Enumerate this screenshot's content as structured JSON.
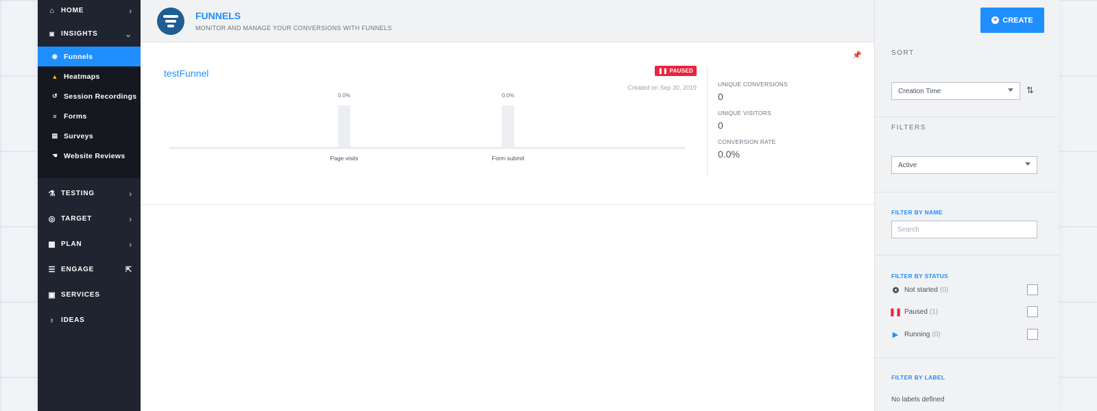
{
  "sidebar": {
    "items": [
      {
        "label": "HOME",
        "icon": "home-icon",
        "glyph": "⌂",
        "trail": "›"
      },
      {
        "label": "INSIGHTS",
        "icon": "insights-icon",
        "glyph": "◙",
        "trail": "⌄"
      }
    ],
    "sub_items": [
      {
        "label": "Funnels",
        "icon": "funnel-icon",
        "glyph": "◉"
      },
      {
        "label": "Heatmaps",
        "icon": "heatmap-icon",
        "glyph": "▲"
      },
      {
        "label": "Session Recordings",
        "icon": "recording-icon",
        "glyph": "↺"
      },
      {
        "label": "Forms",
        "icon": "forms-icon",
        "glyph": "≡"
      },
      {
        "label": "Surveys",
        "icon": "surveys-icon",
        "glyph": "▤"
      },
      {
        "label": "Website Reviews",
        "icon": "reviews-icon",
        "glyph": "☚"
      }
    ],
    "lower_items": [
      {
        "label": "TESTING",
        "icon": "testing-icon",
        "glyph": "⚗",
        "trail": "›"
      },
      {
        "label": "TARGET",
        "icon": "target-icon",
        "glyph": "◎",
        "trail": "›"
      },
      {
        "label": "PLAN",
        "icon": "plan-icon",
        "glyph": "▦",
        "trail": "›"
      },
      {
        "label": "ENGAGE",
        "icon": "engage-icon",
        "glyph": "☰",
        "trail": "⇱"
      },
      {
        "label": "SERVICES",
        "icon": "services-icon",
        "glyph": "▣",
        "trail": ""
      },
      {
        "label": "IDEAS",
        "icon": "ideas-icon",
        "glyph": "♁",
        "trail": ""
      }
    ]
  },
  "header": {
    "title": "FUNNELS",
    "subtitle": "MONITOR AND MANAGE YOUR CONVERSIONS WITH FUNNELS",
    "create_label": "CREATE"
  },
  "funnel": {
    "name": "testFunnel",
    "status_badge": "PAUSED",
    "created": "Created on Sep 30, 2019",
    "stats": [
      {
        "label": "UNIQUE CONVERSIONS",
        "value": "0"
      },
      {
        "label": "UNIQUE VISITORS",
        "value": "0"
      },
      {
        "label": "CONVERSION RATE",
        "value": "0.0%"
      }
    ]
  },
  "chart_data": {
    "type": "bar",
    "categories": [
      "Page visits",
      "Form submit"
    ],
    "values": [
      0.0,
      0.0
    ],
    "data_labels": [
      "0.0%",
      "0.0%"
    ],
    "ylim": [
      0,
      100
    ]
  },
  "panel": {
    "sort_title": "SORT",
    "sort_value": "Creation Time",
    "filters_title": "FILTERS",
    "filter_value": "Active",
    "filter_name_title": "FILTER BY NAME",
    "search_placeholder": "Search",
    "filter_status_title": "FILTER BY STATUS",
    "statuses": [
      {
        "label": "Not started",
        "count": "(0)"
      },
      {
        "label": "Paused",
        "count": "(1)"
      },
      {
        "label": "Running",
        "count": "(0)"
      }
    ],
    "filter_label_title": "FILTER BY LABEL",
    "no_labels": "No labels defined"
  },
  "colors": {
    "accent": "#1f8fff",
    "paused": "#e8243f",
    "sidebar": "#1f2430"
  }
}
